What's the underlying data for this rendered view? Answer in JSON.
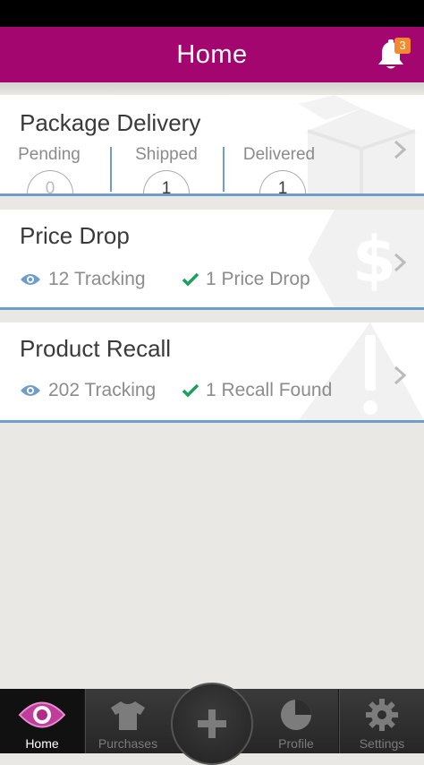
{
  "header": {
    "title": "Home",
    "notification_count": "3"
  },
  "cards": {
    "package": {
      "title": "Package Delivery",
      "columns": [
        {
          "label": "Pending",
          "count": "0"
        },
        {
          "label": "Shipped",
          "count": "1"
        },
        {
          "label": "Delivered",
          "count": "1"
        }
      ]
    },
    "price": {
      "title": "Price Drop",
      "tracking": "12 Tracking",
      "result": "1 Price Drop"
    },
    "recall": {
      "title": "Product Recall",
      "tracking": "202 Tracking",
      "result": "1 Recall Found"
    }
  },
  "tabbar": {
    "tabs": [
      {
        "label": "Home",
        "icon": "eye-icon"
      },
      {
        "label": "Purchases",
        "icon": "shirt-icon"
      },
      {
        "label": "",
        "icon": "plus-icon"
      },
      {
        "label": "Profile",
        "icon": "pie-chart-icon"
      },
      {
        "label": "Settings",
        "icon": "gear-icon"
      }
    ]
  },
  "colors": {
    "header": "#a3066f",
    "accent_blue": "#6e9ccb",
    "check_green": "#1aa15b",
    "badge": "#f2892f"
  }
}
